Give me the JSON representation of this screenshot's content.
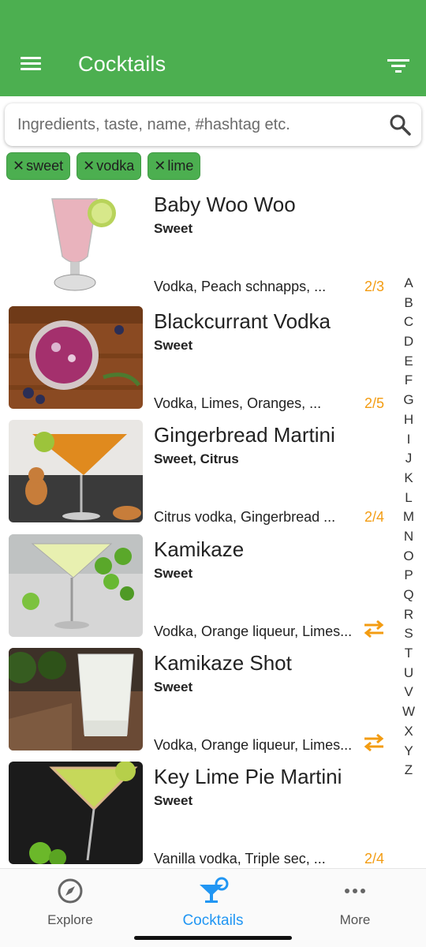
{
  "appbar": {
    "title": "Cocktails",
    "color": "#4caf50"
  },
  "search": {
    "placeholder": "Ingredients, taste, name, #hashtag etc."
  },
  "chips": [
    {
      "label": "sweet"
    },
    {
      "label": "vodka"
    },
    {
      "label": "lime"
    }
  ],
  "cocktails": [
    {
      "name": "Baby Woo Woo",
      "taste": "Sweet",
      "ingredients": "Vodka, Peach schnapps, ...",
      "match": "2/3"
    },
    {
      "name": "Blackcurrant Vodka",
      "taste": "Sweet",
      "ingredients": "Vodka, Limes, Oranges, ...",
      "match": "2/5"
    },
    {
      "name": "Gingerbread Martini",
      "taste": "Sweet, Citrus",
      "ingredients": "Citrus vodka, Gingerbread ...",
      "match": "2/4"
    },
    {
      "name": "Kamikaze",
      "taste": "Sweet",
      "ingredients": "Vodka, Orange liqueur, Limes...",
      "match": ""
    },
    {
      "name": "Kamikaze Shot",
      "taste": "Sweet",
      "ingredients": "Vodka, Orange liqueur, Limes...",
      "match": ""
    },
    {
      "name": "Key Lime Pie Martini",
      "taste": "Sweet",
      "ingredients": "Vanilla vodka, Triple sec, ...",
      "match": "2/4"
    }
  ],
  "alphabet": [
    "A",
    "B",
    "C",
    "D",
    "E",
    "F",
    "G",
    "H",
    "I",
    "J",
    "K",
    "L",
    "M",
    "N",
    "O",
    "P",
    "Q",
    "R",
    "S",
    "T",
    "U",
    "V",
    "W",
    "X",
    "Y",
    "Z"
  ],
  "nav": {
    "explore": "Explore",
    "cocktails": "Cocktails",
    "more": "More"
  },
  "colors": {
    "accent": "#2196f3",
    "match": "#f39c12",
    "chip": "#4caf50"
  }
}
